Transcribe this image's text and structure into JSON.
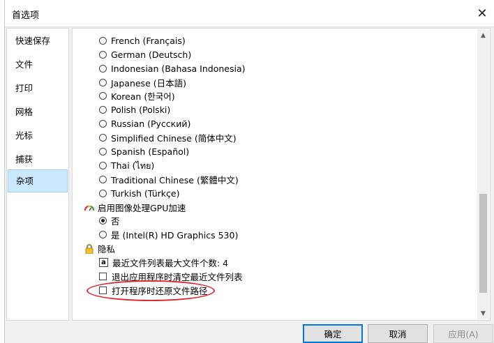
{
  "window": {
    "title": "首选项"
  },
  "sidebar": {
    "items": [
      {
        "label": "快速保存"
      },
      {
        "label": "文件"
      },
      {
        "label": "打印"
      },
      {
        "label": "网格"
      },
      {
        "label": "光标"
      },
      {
        "label": "捕获"
      },
      {
        "label": "杂项",
        "selected": true
      }
    ]
  },
  "languages": [
    "French (Français)",
    "German (Deutsch)",
    "Indonesian (Bahasa Indonesia)",
    "Japanese (日本語)",
    "Korean (한국어)",
    "Polish (Polski)",
    "Russian (Русский)",
    "Simplified Chinese (简体中文)",
    "Spanish (Español)",
    "Thai (ไทย)",
    "Traditional Chinese (繁體中文)",
    "Turkish (Türkçe)"
  ],
  "gpu": {
    "heading": "启用图像处理GPU加速",
    "options": [
      {
        "label": "否",
        "selected": true
      },
      {
        "label": "是 (Intel(R) HD Graphics 530)",
        "selected": false
      }
    ]
  },
  "privacy": {
    "heading": "隐私",
    "max_recent_label": "最近文件列表最大文件个数: 4",
    "clear_on_exit_label": "退出应用程序时清空最近文件列表",
    "restore_path_label": "打开程序时还原文件路径"
  },
  "buttons": {
    "ok": "确定",
    "cancel": "取消",
    "apply": "应用(A)"
  },
  "colors": {
    "highlight": "#e0282f",
    "selection": "#cce8ff",
    "accent": "#0078d7"
  }
}
